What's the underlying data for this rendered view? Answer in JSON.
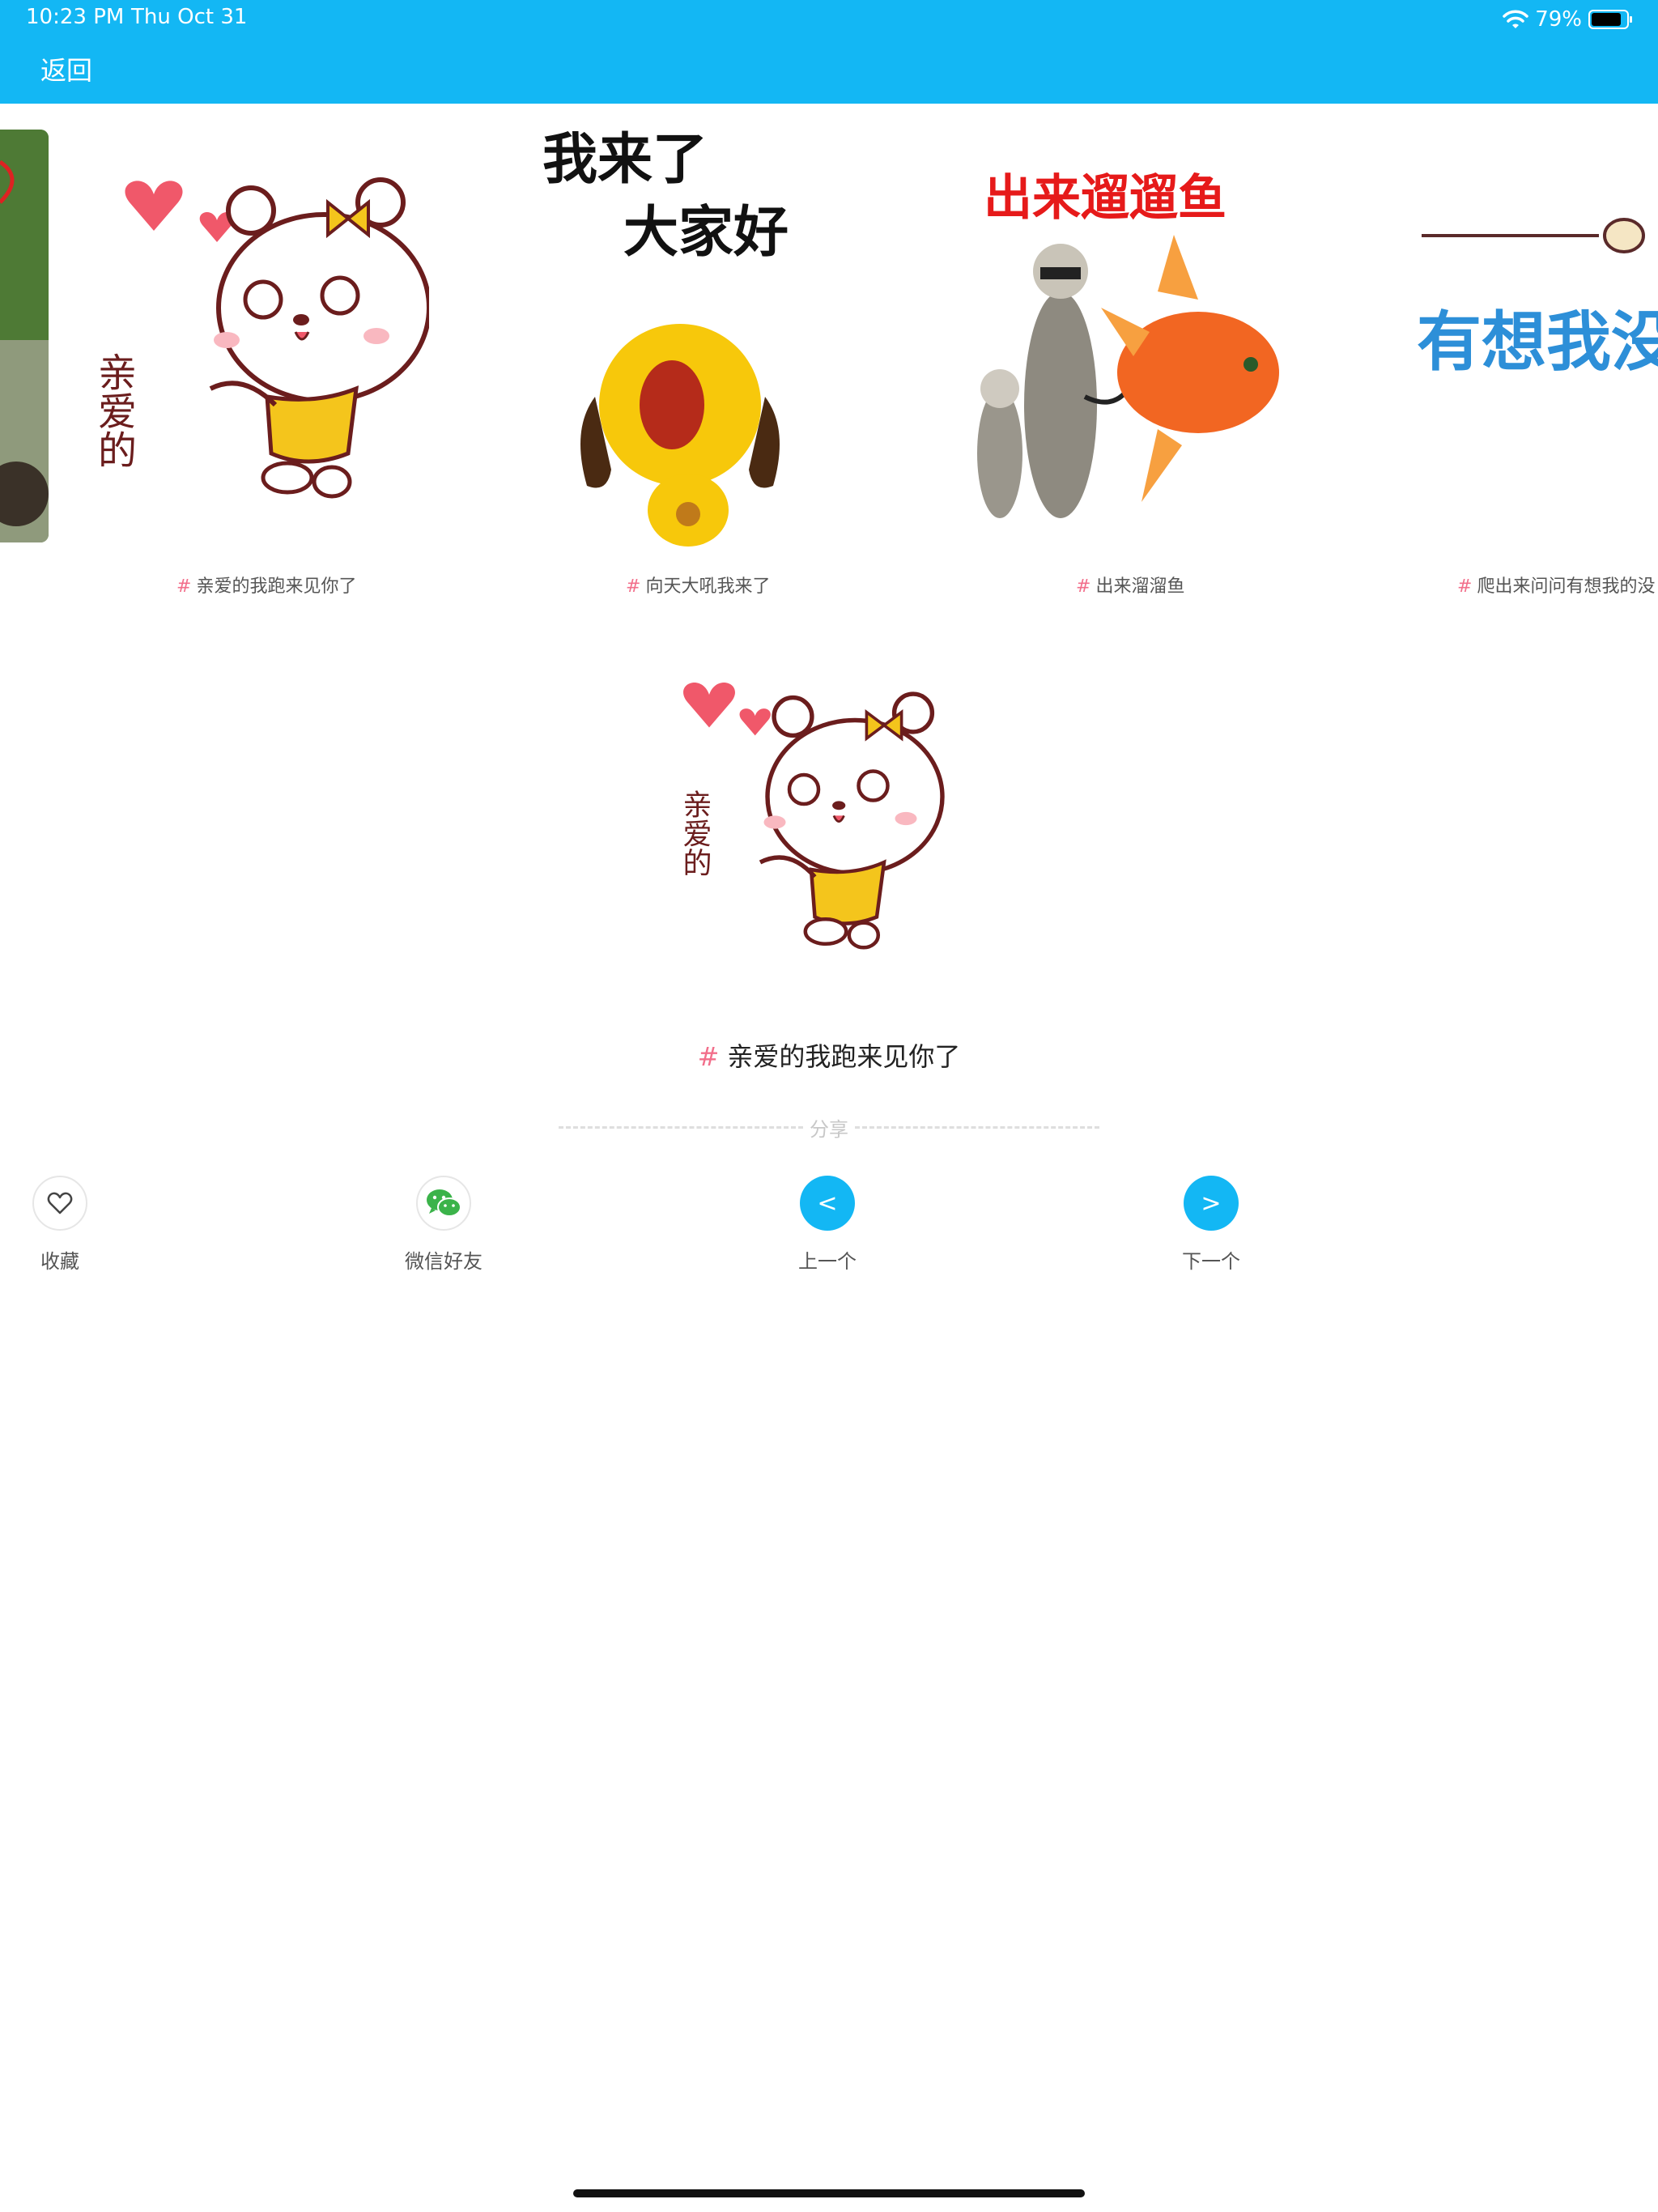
{
  "status_bar": {
    "time": "10:23 PM",
    "date": "Thu Oct 31",
    "battery": "79%"
  },
  "nav": {
    "back_label": "返回"
  },
  "carousel": {
    "items": [
      {
        "hash": "#",
        "caption": "亲爱的我跑来见你了",
        "image": "bear-hearts-sticker",
        "image_text": "亲爱的"
      },
      {
        "hash": "#",
        "caption": "向天大吼我来了",
        "image": "yellow-dog-shout-sticker",
        "image_text": "我来了 大家好"
      },
      {
        "hash": "#",
        "caption": "出来溜溜鱼",
        "image": "raccoon-walking-fish-sticker",
        "image_text": "出来遛遛鱼"
      },
      {
        "hash": "#",
        "caption": "爬出来问问有想我的没",
        "image": "blue-text-sticker",
        "image_text": "有想我没"
      }
    ]
  },
  "detail": {
    "hash": "#",
    "title": "亲爱的我跑来见你了",
    "image": "bear-hearts-sticker",
    "image_text": "亲爱的"
  },
  "share": {
    "label": "分享"
  },
  "actions": [
    {
      "label": "收藏",
      "icon": "heart-icon"
    },
    {
      "label": "微信好友",
      "icon": "wechat-icon"
    },
    {
      "label": "上一个",
      "icon": "<"
    },
    {
      "label": "下一个",
      "icon": ">"
    }
  ],
  "colors": {
    "accent": "#13b7f4",
    "hash": "#f26f8b",
    "wechat": "#3bb34a"
  }
}
